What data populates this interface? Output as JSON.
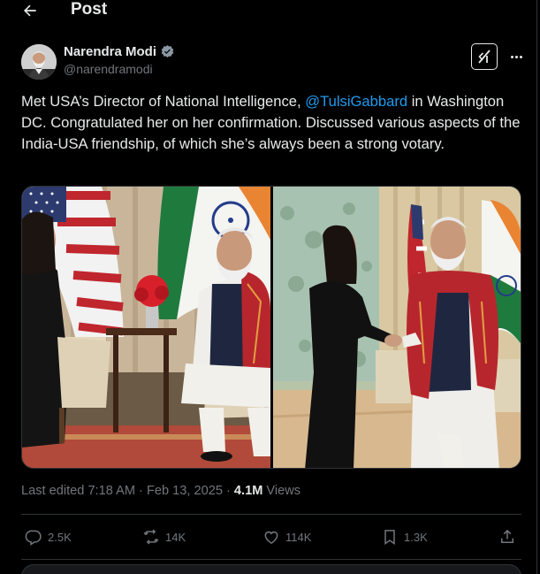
{
  "header": {
    "title": "Post"
  },
  "author": {
    "name": "Narendra Modi",
    "handle": "@narendramodi",
    "verified": true
  },
  "post": {
    "text_before": "Met USA’s Director of National Intelligence, ",
    "mention": "@TulsiGabbard",
    "text_after": " in Washington DC. Congratulated her on her confirmation. Discussed various aspects of the India-USA friendship, of which she’s always been a strong votary."
  },
  "meta": {
    "edited": "Last edited 7:18 AM · Feb 13, 2025 ·",
    "views_count": "4.1M",
    "views_label": "Views"
  },
  "actions": {
    "replies": "2.5K",
    "reposts": "14K",
    "likes": "114K",
    "bookmarks": "1.3K"
  },
  "colors": {
    "background": "#000000",
    "text": "#e7e9ea",
    "muted": "#71767b",
    "accent": "#1d9bf0",
    "border": "#2f3336"
  },
  "icons": [
    "back-arrow-icon",
    "verified-badge-icon",
    "grok-icon",
    "more-icon",
    "reply-icon",
    "repost-icon",
    "like-icon",
    "bookmark-icon",
    "share-icon"
  ]
}
